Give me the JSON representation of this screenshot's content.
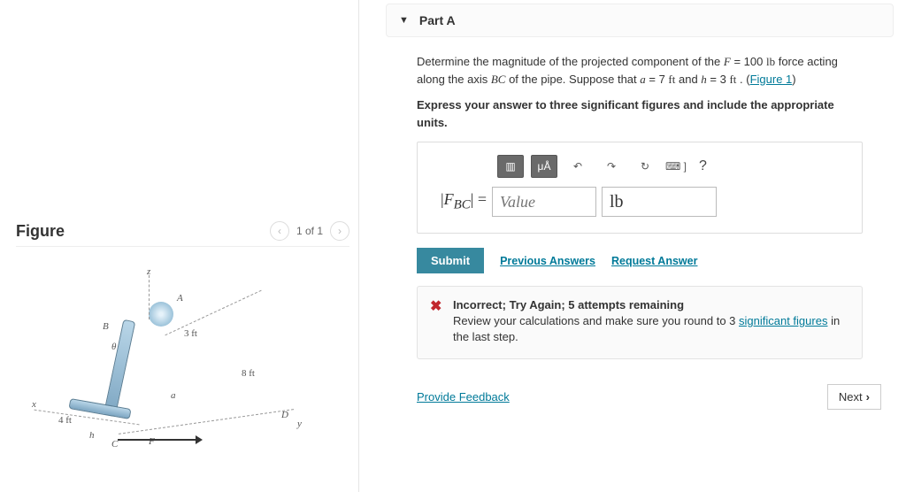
{
  "figure": {
    "title": "Figure",
    "pager": "1 of 1",
    "labels": {
      "z": "z",
      "A": "A",
      "B": "B",
      "C": "C",
      "D": "D",
      "F": "F",
      "x": "x",
      "y": "y",
      "h": "h",
      "a": "a",
      "theta": "θ",
      "dim3ft": "3 ft",
      "dim8ft": "8 ft",
      "dim4ft": "4 ft"
    }
  },
  "part": {
    "label": "Part A"
  },
  "prompt": {
    "line1a": "Determine the magnitude of the projected component of the ",
    "F_eq": "F = 100 lb",
    "line1b": " force acting along the axis ",
    "BC": "BC",
    "line1c": " of the pipe. Suppose that ",
    "a_eq": "a = 7 ft",
    "and": " and ",
    "h_eq": "h = 3 ft",
    "period": " . (",
    "fig_link": "Figure 1",
    "close": ")",
    "bold": "Express your answer to three significant figures and include the appropriate units."
  },
  "toolbar": {
    "templates": "▥",
    "units_btn": "μÅ",
    "undo": "↶",
    "redo": "↷",
    "reset": "↻",
    "keyboard": "⌨ ]",
    "help": "?"
  },
  "answer": {
    "lhs": "|F",
    "lhs_sub": "BC",
    "lhs_tail": "| =",
    "value_placeholder": "Value",
    "units_value": "lb"
  },
  "actions": {
    "submit": "Submit",
    "previous": "Previous Answers",
    "request": "Request Answer"
  },
  "feedback": {
    "title": "Incorrect; Try Again; 5 attempts remaining",
    "body_a": "Review your calculations and make sure you round to 3 ",
    "sigfig_link": "significant figures",
    "body_b": " in the last step."
  },
  "footer": {
    "provide": "Provide Feedback",
    "next": "Next"
  }
}
